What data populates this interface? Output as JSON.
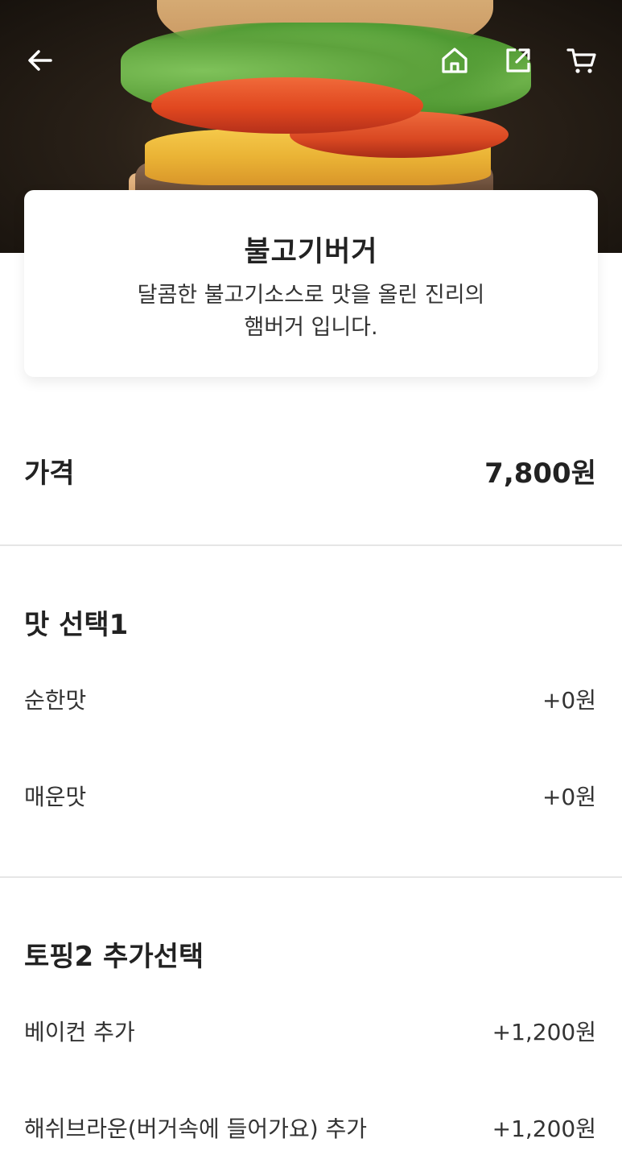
{
  "header": {
    "back_icon": "arrow-left-icon",
    "home_icon": "home-icon",
    "share_icon": "share-icon",
    "cart_icon": "cart-icon"
  },
  "product": {
    "name": "불고기버거",
    "description_line1": "달콤한 불고기소스로 맛을 올린 진리의",
    "description_line2": "햄버거 입니다."
  },
  "price": {
    "label": "가격",
    "value": "7,800원"
  },
  "option_groups": [
    {
      "title": "맛 선택1",
      "options": [
        {
          "name": "순한맛",
          "price": "+0원"
        },
        {
          "name": "매운맛",
          "price": "+0원"
        }
      ]
    },
    {
      "title": "토핑2 추가선택",
      "options": [
        {
          "name": "베이컨 추가",
          "price": "+1,200원"
        },
        {
          "name": "해쉬브라운(버거속에 들어가요) 추가",
          "price": "+1,200원"
        }
      ]
    }
  ],
  "colors": {
    "text": "#222222",
    "divider": "#e6e6e6",
    "card_bg": "#ffffff"
  }
}
